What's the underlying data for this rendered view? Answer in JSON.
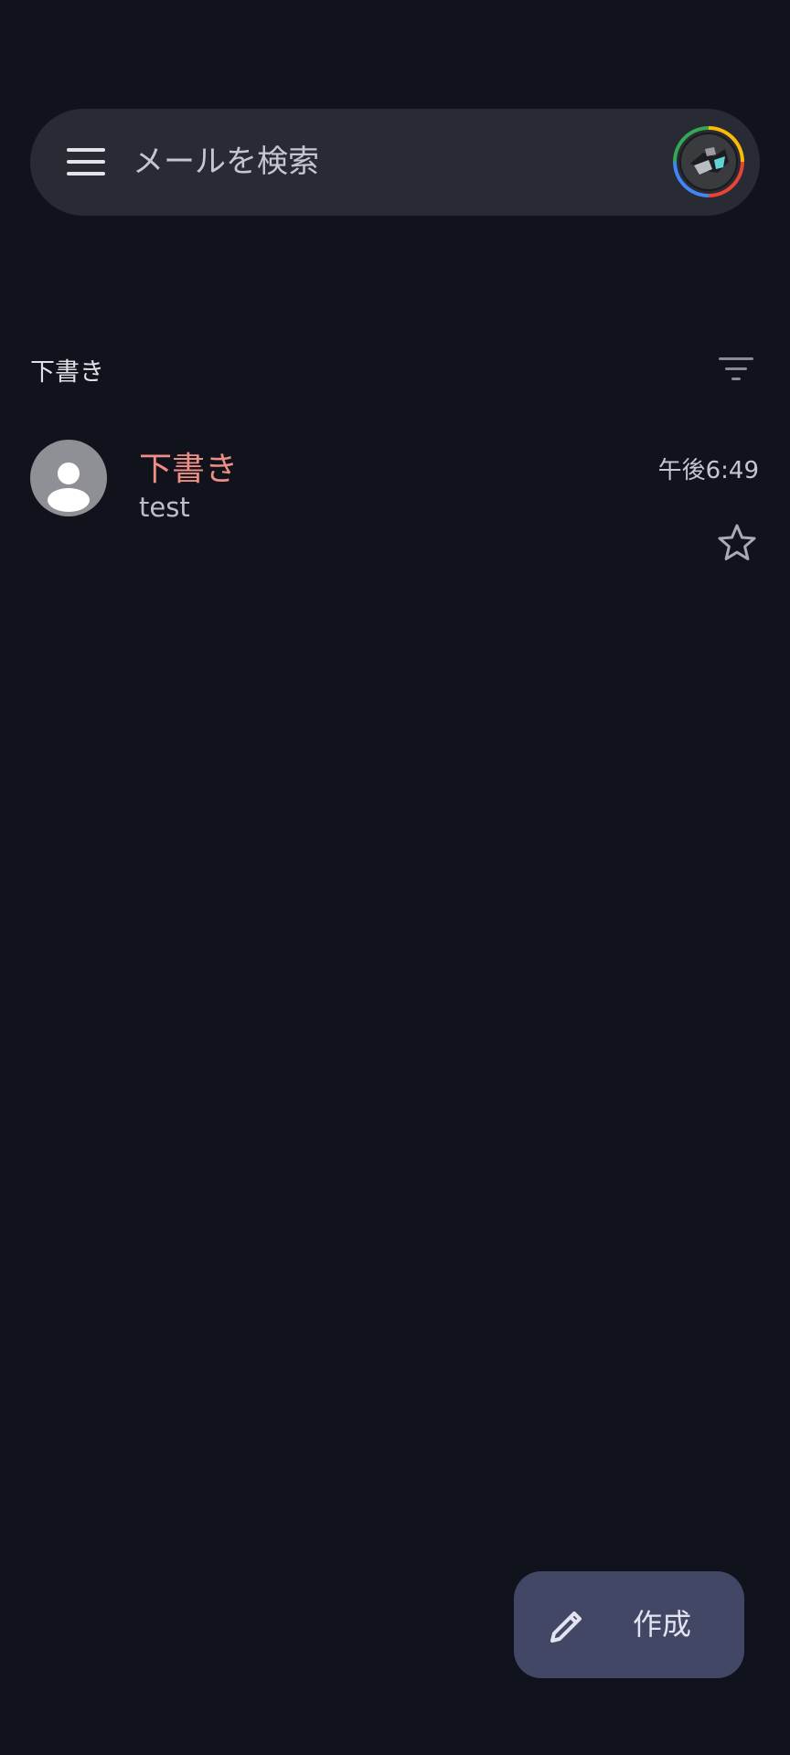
{
  "search": {
    "placeholder": "メールを検索",
    "menu_icon": "hamburger-menu-icon",
    "account_icon": "account-avatar"
  },
  "section": {
    "title": "下書き",
    "filter_icon": "filter-icon"
  },
  "emails": [
    {
      "label": "下書き",
      "subject": "test",
      "time": "午後6:49",
      "starred": false,
      "label_color": "#ee8e84"
    }
  ],
  "compose": {
    "label": "作成",
    "icon": "pencil-icon"
  },
  "colors": {
    "background": "#11131c",
    "search_bar": "#282a34",
    "fab": "#434766",
    "draft_accent": "#ee8e84"
  }
}
